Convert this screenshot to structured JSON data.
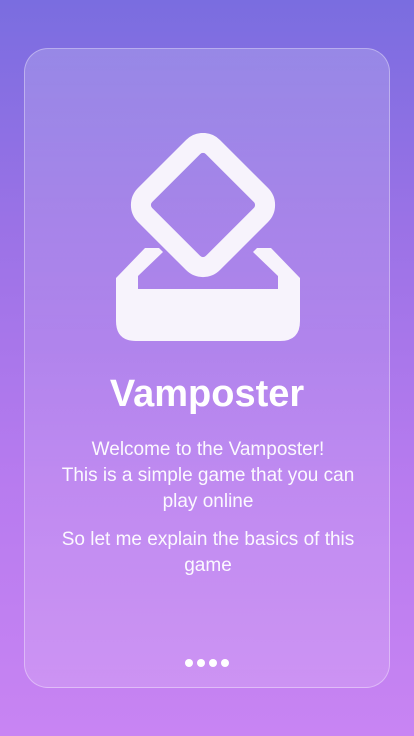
{
  "onboarding": {
    "logo_icon": "tilted-square-in-tray-icon",
    "title": "Vamposter",
    "description_line1": "Welcome to the Vamposter!",
    "description_line2": "This is a simple game that you can play online",
    "description_line3": "So let me explain the basics of this game",
    "pagination": {
      "total_pages": 4,
      "current_page": 1
    }
  },
  "colors": {
    "background_top": "#7a6de0",
    "background_bottom": "#c884f3",
    "text": "#ffffff"
  }
}
